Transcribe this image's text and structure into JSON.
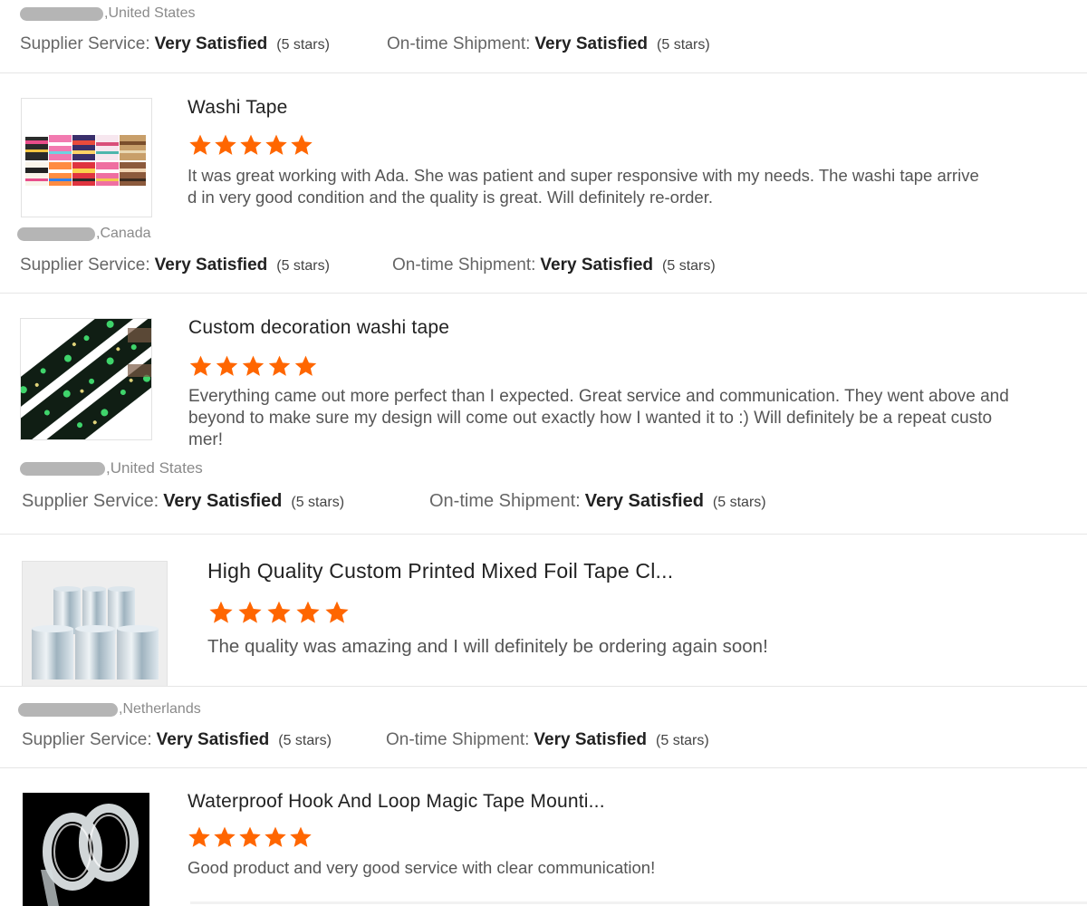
{
  "star_color": "#ff6600",
  "reviews": [
    {
      "country": "United States",
      "supplier_service_label": "Supplier Service:",
      "supplier_service_value": "Very Satisfied",
      "supplier_service_stars": "(5 stars)",
      "shipment_label": "On-time Shipment:",
      "shipment_value": "Very Satisfied",
      "shipment_stars": "(5 stars)"
    },
    {
      "product_title": "Washi Tape",
      "rating": 5,
      "text_lines": [
        "It was great working with Ada. She was patient and super responsive with my needs. The washi tape arrive",
        "d in very good condition and the quality is great. Will definitely re-order."
      ],
      "country": "Canada",
      "supplier_service_label": "Supplier Service:",
      "supplier_service_value": "Very Satisfied",
      "supplier_service_stars": "(5 stars)",
      "shipment_label": "On-time Shipment:",
      "shipment_value": "Very Satisfied",
      "shipment_stars": "(5 stars)"
    },
    {
      "product_title": "Custom decoration washi tape",
      "rating": 5,
      "text_lines": [
        "Everything came out more perfect than I expected. Great service and communication. They went above and",
        "beyond to make sure my design will come out exactly how I wanted it to :) Will definitely be a repeat custo",
        "mer!"
      ],
      "country": "United States",
      "supplier_service_label": "Supplier Service:",
      "supplier_service_value": "Very Satisfied",
      "supplier_service_stars": "(5 stars)",
      "shipment_label": "On-time Shipment:",
      "shipment_value": "Very Satisfied",
      "shipment_stars": "(5 stars)"
    },
    {
      "product_title": "High Quality Custom Printed Mixed Foil Tape Cl...",
      "rating": 5,
      "text_lines": [
        "The quality was amazing and I will definitely be ordering again soon!"
      ],
      "country": "Netherlands",
      "supplier_service_label": "Supplier Service:",
      "supplier_service_value": "Very Satisfied",
      "supplier_service_stars": "(5 stars)",
      "shipment_label": "On-time Shipment:",
      "shipment_value": "Very Satisfied",
      "shipment_stars": "(5 stars)"
    },
    {
      "product_title": "Waterproof Hook And Loop Magic Tape Mounti...",
      "rating": 5,
      "text_lines": [
        "Good product and very good service with clear communication!"
      ]
    }
  ]
}
